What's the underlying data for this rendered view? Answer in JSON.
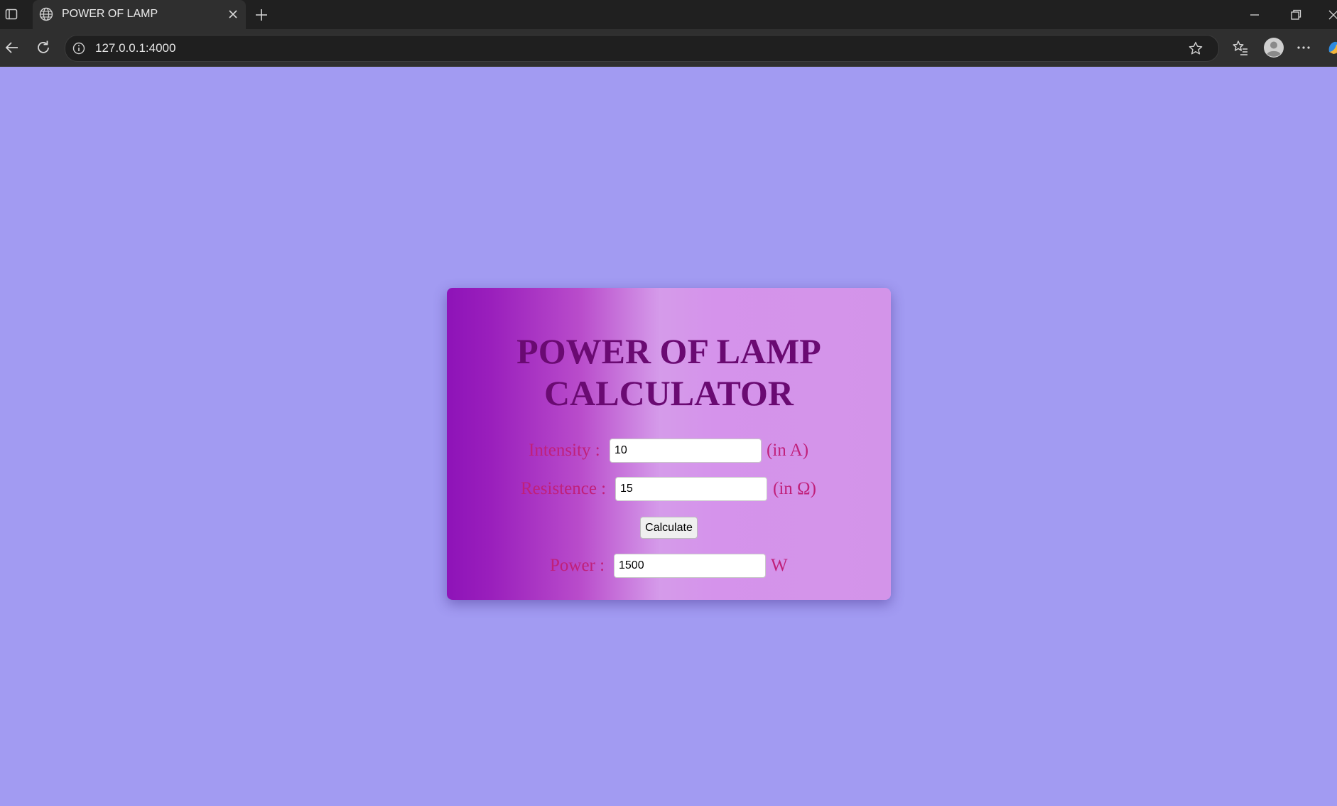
{
  "browser": {
    "tab_title": "POWER OF LAMP",
    "url": "127.0.0.1:4000"
  },
  "page": {
    "background_color": "#a29bf2",
    "title": "POWER OF LAMP CALCULATOR",
    "title_line1": "POWER OF LAMP",
    "title_line2": "CALCULATOR",
    "intensity": {
      "label": "Intensity :",
      "value": "10",
      "unit": "(in A)"
    },
    "resistance": {
      "label": "Resistence :",
      "value": "15",
      "unit": "(in Ω)"
    },
    "calculate_label": "Calculate",
    "power": {
      "label": "Power :",
      "value": "1500",
      "unit": "W"
    }
  },
  "colors": {
    "title": "#6a0a72",
    "labels": "#c0207a",
    "card_gradient_start": "#8e13b8",
    "card_gradient_end": "#d394e9"
  }
}
